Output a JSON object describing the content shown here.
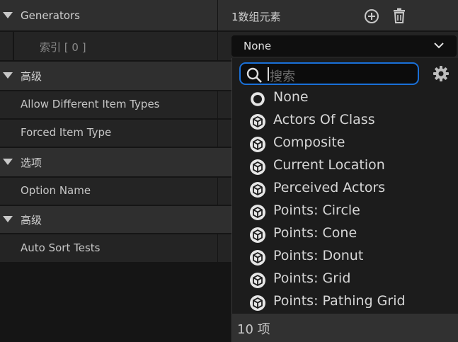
{
  "generators": {
    "label": "Generators",
    "value": "1数组元素",
    "index_label": "索引 [ 0 ]",
    "selected": "None"
  },
  "sections": [
    {
      "label": "高级"
    },
    {
      "label": "选项"
    },
    {
      "label": "高级"
    }
  ],
  "properties": {
    "allow_different": "Allow Different Item Types",
    "forced_item_type": "Forced Item Type",
    "option_name": "Option Name",
    "auto_sort_tests": "Auto Sort Tests"
  },
  "dropdown": {
    "search_placeholder": "搜索",
    "items": [
      {
        "label": "None",
        "icon": "circle-icon"
      },
      {
        "label": "Actors Of Class",
        "icon": "cube-icon"
      },
      {
        "label": "Composite",
        "icon": "cube-icon"
      },
      {
        "label": "Current Location",
        "icon": "cube-icon"
      },
      {
        "label": "Perceived Actors",
        "icon": "cube-icon"
      },
      {
        "label": "Points: Circle",
        "icon": "cube-icon"
      },
      {
        "label": "Points: Cone",
        "icon": "cube-icon"
      },
      {
        "label": "Points: Donut",
        "icon": "cube-icon"
      },
      {
        "label": "Points: Grid",
        "icon": "cube-icon"
      },
      {
        "label": "Points: Pathing Grid",
        "icon": "cube-icon"
      }
    ],
    "count_label": "10 项"
  },
  "colors": {
    "accent": "#1a70d8",
    "panel": "#242424",
    "category": "#2f2f2f"
  }
}
